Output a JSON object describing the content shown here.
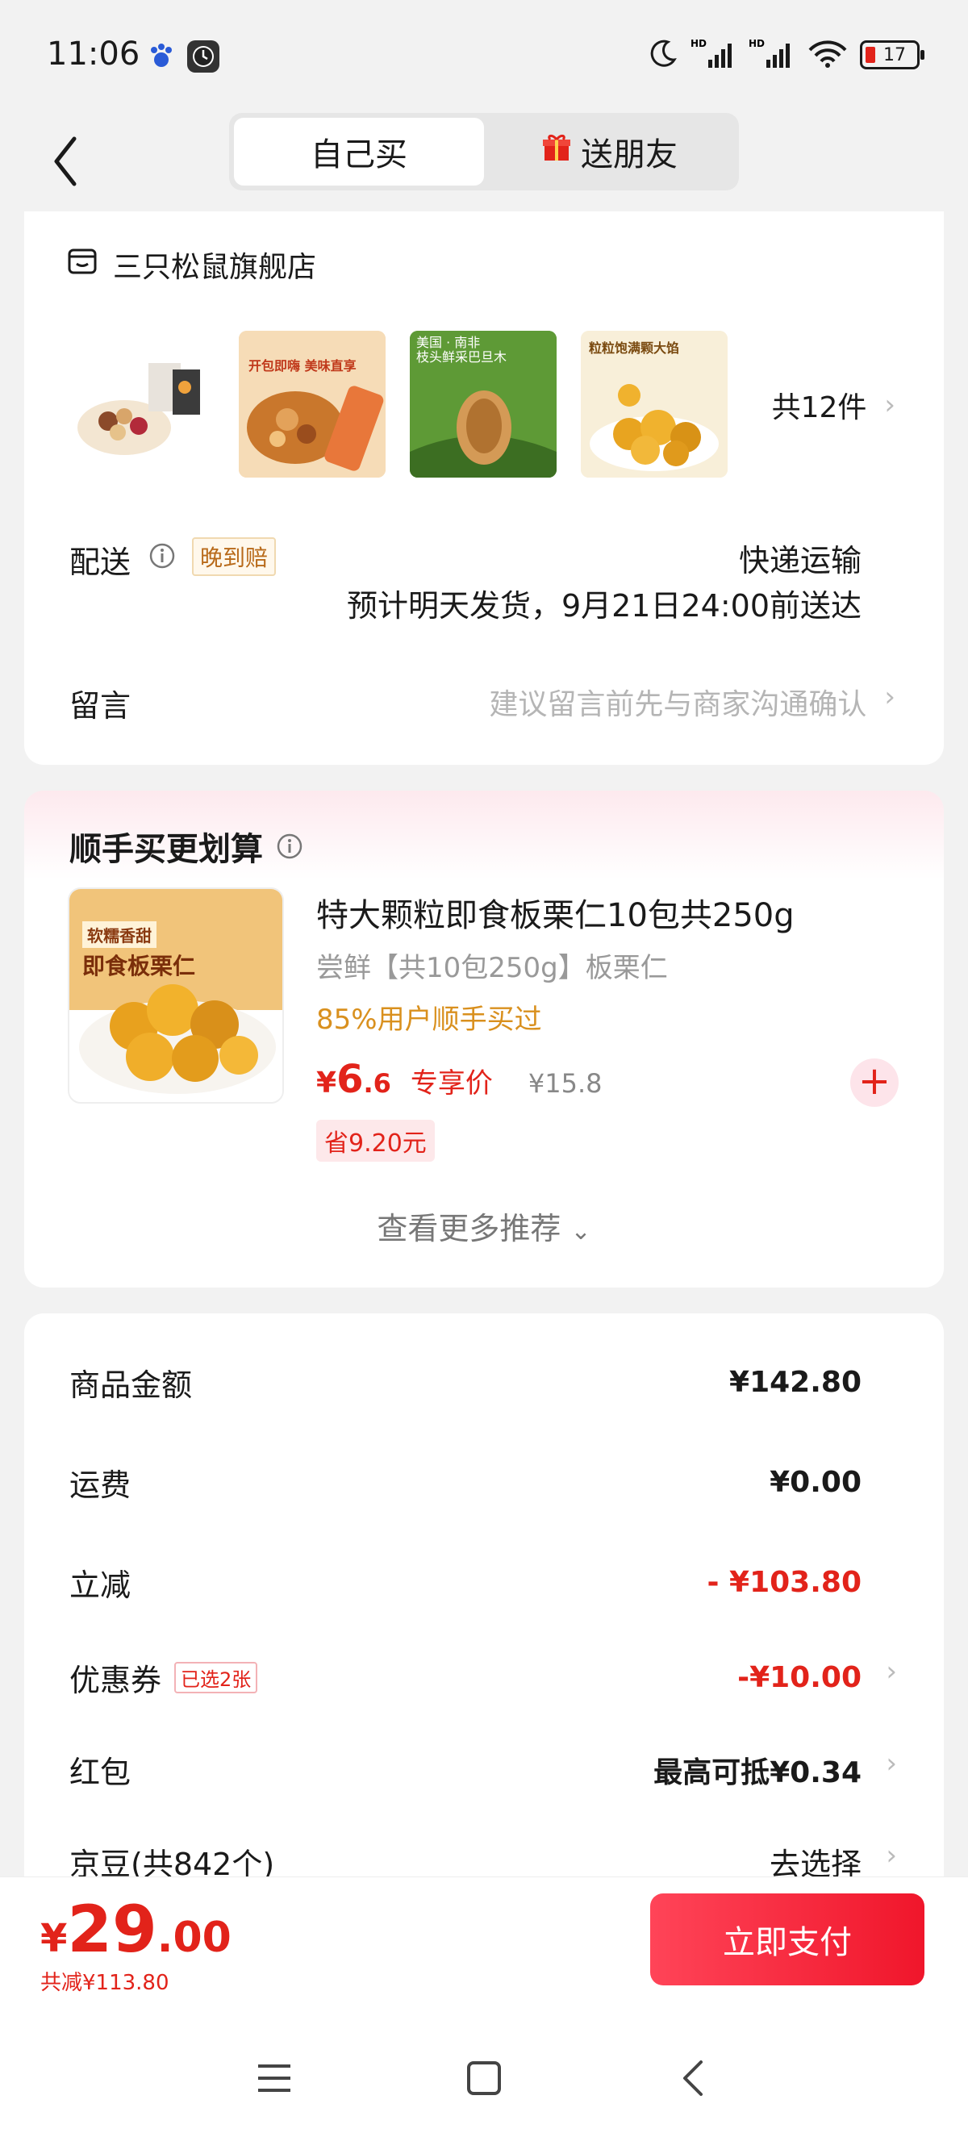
{
  "status_bar": {
    "time": "11:06",
    "battery": "17"
  },
  "header": {
    "tabs": [
      {
        "label": "自己买",
        "active": true
      },
      {
        "label": "送朋友",
        "active": false
      }
    ]
  },
  "store": {
    "name": "三只松鼠旗舰店",
    "item_count": "共12件",
    "thumbs": [
      {
        "caption": ""
      },
      {
        "caption": "开包即嗨 美味直享"
      },
      {
        "caption": "美国 · 南非\n枝头鲜采巴旦木"
      },
      {
        "caption": "粒粒饱满颗大馅"
      }
    ],
    "delivery_label": "配送",
    "late_badge": "晚到赔",
    "delivery_method": "快递运输",
    "delivery_eta": "预计明天发货，9月21日24:00前送达",
    "message_label": "留言",
    "message_placeholder": "建议留言前先与商家沟通确认"
  },
  "recommend": {
    "title": "顺手买更划算",
    "product_name": "特大颗粒即食板栗仁10包共250g",
    "product_sub": "尝鲜【共10包250g】板栗仁",
    "buyers": "85%用户顺手买过",
    "price_currency": "¥",
    "price_int": "6",
    "price_dec": ".6",
    "price_label": "专享价",
    "original_price": "¥15.8",
    "save_text": "省9.20元",
    "img_text_top": "软糯香甜",
    "img_text_main": "即食板栗仁",
    "more_label": "查看更多推荐"
  },
  "summary": {
    "rows": [
      {
        "label": "商品金额",
        "value": "¥142.80"
      },
      {
        "label": "运费",
        "value": "¥0.00"
      },
      {
        "label": "立减",
        "value": "- ¥103.80"
      },
      {
        "label": "优惠券",
        "badge": "已选2张",
        "value": "-¥10.00"
      },
      {
        "label": "红包",
        "value": "最高可抵¥0.34"
      },
      {
        "label": "京豆(共842个)",
        "value": "去选择"
      }
    ]
  },
  "bottom": {
    "currency": "¥",
    "total_int": "29",
    "total_dec": ".00",
    "total_save": "共减¥113.80",
    "pay_label": "立即支付"
  },
  "colors": {
    "accent": "#e2231a",
    "buyers": "#d9901e"
  }
}
